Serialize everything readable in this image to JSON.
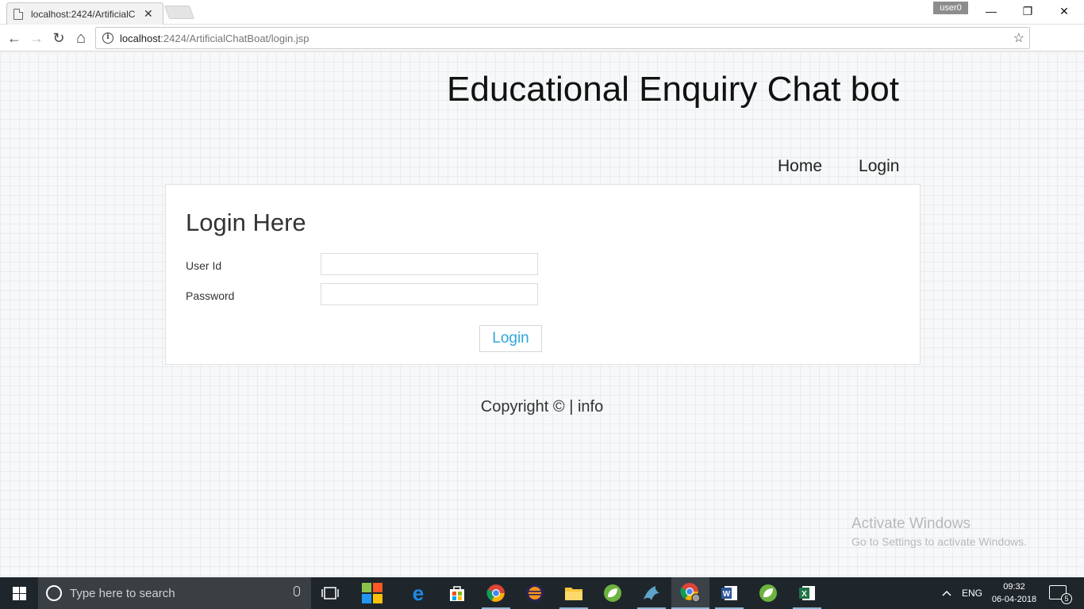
{
  "browser": {
    "tab_title": "localhost:2424/ArtificialC",
    "close_glyph": "✕",
    "user_badge": "user0",
    "window_controls": {
      "minimize": "—",
      "restore": "❐",
      "close": "✕"
    },
    "url_host": "localhost",
    "url_rest": ":2424/ArtificialChatBoat/login.jsp",
    "nav": {
      "back": "←",
      "forward": "→",
      "reload": "↻",
      "home": "⌂"
    },
    "info_glyph": "i",
    "star_glyph": "☆",
    "menu_glyph": "⋮"
  },
  "page": {
    "title": "Educational Enquiry Chat bot",
    "nav": [
      {
        "label": "Home"
      },
      {
        "label": "Login"
      }
    ],
    "form": {
      "heading": "Login Here",
      "user_label": "User Id",
      "user_value": "",
      "password_label": "Password",
      "password_value": "",
      "submit_label": "Login"
    },
    "footer": {
      "copyright": "Copyright © | ",
      "info_link": "info"
    }
  },
  "watermark": {
    "line1": "Activate Windows",
    "line2": "Go to Settings to activate Windows."
  },
  "taskbar": {
    "search_placeholder": "Type here to search",
    "apps": [
      {
        "icon": "task-view-icon"
      },
      {
        "icon": "colorful-app-icon"
      },
      {
        "icon": "edge-icon"
      },
      {
        "icon": "store-icon"
      },
      {
        "icon": "chrome-icon"
      },
      {
        "icon": "eclipse-icon"
      },
      {
        "icon": "file-explorer-icon"
      },
      {
        "icon": "spring-tool-icon"
      },
      {
        "icon": "mysql-dolphin-icon"
      },
      {
        "icon": "chrome-user-icon"
      },
      {
        "icon": "word-icon"
      },
      {
        "icon": "spring-tool-icon"
      },
      {
        "icon": "excel-icon"
      }
    ],
    "language": "ENG",
    "time": "09:32",
    "date": "06-04-2018",
    "notification_count": "5"
  },
  "colors": {
    "accent_button_text": "#2fa7d8",
    "taskbar_bg": "#1f262b",
    "opera_red": "#e0161b"
  }
}
